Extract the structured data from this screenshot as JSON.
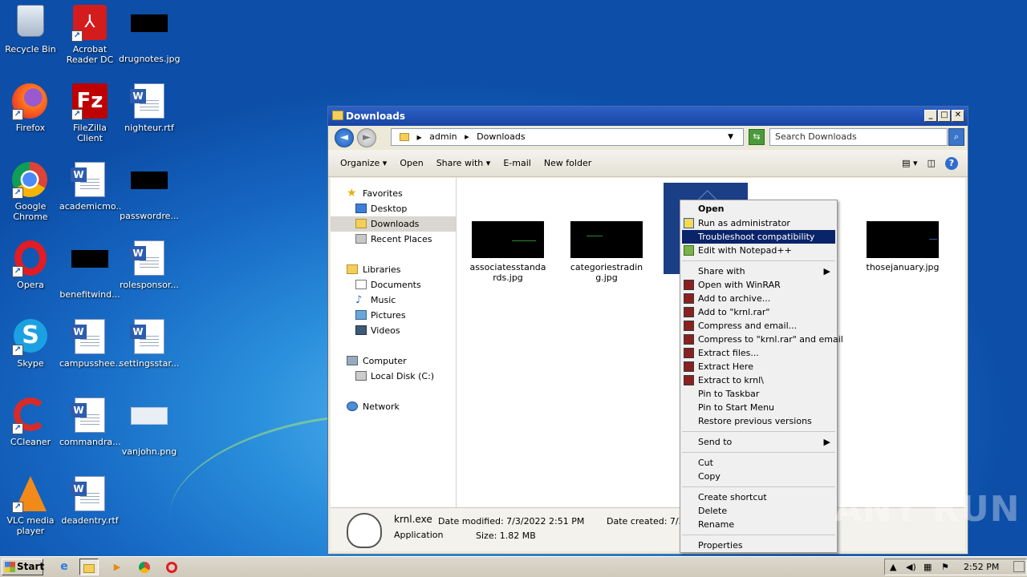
{
  "desktop_icons": [
    {
      "label": "Recycle Bin",
      "icon": "recycle-bin-icon"
    },
    {
      "label": "Acrobat Reader DC",
      "icon": "acrobat-icon"
    },
    {
      "label": "drugnotes.jpg",
      "icon": "image-file-icon"
    },
    {
      "label": "Firefox",
      "icon": "firefox-icon"
    },
    {
      "label": "FileZilla Client",
      "icon": "filezilla-icon"
    },
    {
      "label": "nighteur.rtf",
      "icon": "word-doc-icon"
    },
    {
      "label": "Google Chrome",
      "icon": "chrome-icon"
    },
    {
      "label": "academicmo...",
      "icon": "word-doc-icon"
    },
    {
      "label": "passwordre...",
      "icon": "image-file-icon"
    },
    {
      "label": "Opera",
      "icon": "opera-icon"
    },
    {
      "label": "benefitwind...",
      "icon": "image-file-icon"
    },
    {
      "label": "rolesponsor...",
      "icon": "word-doc-icon"
    },
    {
      "label": "Skype",
      "icon": "skype-icon"
    },
    {
      "label": "campusshee...",
      "icon": "word-doc-icon"
    },
    {
      "label": "settingsstar...",
      "icon": "word-doc-icon"
    },
    {
      "label": "CCleaner",
      "icon": "ccleaner-icon"
    },
    {
      "label": "commandra...",
      "icon": "word-doc-icon"
    },
    {
      "label": "vanjohn.png",
      "icon": "image-file-icon"
    },
    {
      "label": "VLC media player",
      "icon": "vlc-icon"
    },
    {
      "label": "deadentry.rtf",
      "icon": "word-doc-icon"
    }
  ],
  "window": {
    "title": "Downloads",
    "controls": {
      "minimize": "_",
      "maximize": "□",
      "close": "✕"
    },
    "back_glyph": "◄",
    "forward_glyph": "►",
    "breadcrumb": [
      "admin",
      "Downloads"
    ],
    "breadcrumb_sep": "▸",
    "search_placeholder": "Search Downloads",
    "toolbar": {
      "organize": "Organize ▾",
      "open": "Open",
      "share_with": "Share with ▾",
      "email": "E-mail",
      "new_folder": "New folder"
    },
    "nav": {
      "favorites": "Favorites",
      "desktop": "Desktop",
      "downloads": "Downloads",
      "recent": "Recent Places",
      "libraries": "Libraries",
      "documents": "Documents",
      "music": "Music",
      "pictures": "Pictures",
      "videos": "Videos",
      "computer": "Computer",
      "local_disk": "Local Disk (C:)",
      "network": "Network"
    },
    "files": [
      {
        "name": "associatesstandards.jpg"
      },
      {
        "name": "categoriestrading.jpg"
      },
      {
        "name": "krnl.exe"
      },
      {
        "name": "thosejanuary.jpg"
      }
    ],
    "details": {
      "filename": "krnl.exe",
      "type": "Application",
      "date_modified": "Date modified: 7/3/2022 2:51 PM",
      "size": "Size: 1.82 MB",
      "date_created": "Date created: 7/3/2"
    }
  },
  "context_menu": {
    "open": "Open",
    "run_as_admin": "Run as administrator",
    "troubleshoot": "Troubleshoot compatibility",
    "edit_npp": "Edit with Notepad++",
    "share_with": "Share with",
    "open_winrar": "Open with WinRAR",
    "add_archive": "Add to archive...",
    "add_krnl_rar": "Add to \"krnl.rar\"",
    "compress_email": "Compress and email...",
    "compress_krnl_email": "Compress to \"krnl.rar\" and email",
    "extract_files": "Extract files...",
    "extract_here": "Extract Here",
    "extract_to": "Extract to krnl\\",
    "pin_taskbar": "Pin to Taskbar",
    "pin_start": "Pin to Start Menu",
    "restore": "Restore previous versions",
    "send_to": "Send to",
    "cut": "Cut",
    "copy": "Copy",
    "create_shortcut": "Create shortcut",
    "delete": "Delete",
    "rename": "Rename",
    "properties": "Properties",
    "submenu_arrow": "▶"
  },
  "taskbar": {
    "start": "Start",
    "clock": "2:52 PM"
  },
  "watermark": "ANY RUN"
}
